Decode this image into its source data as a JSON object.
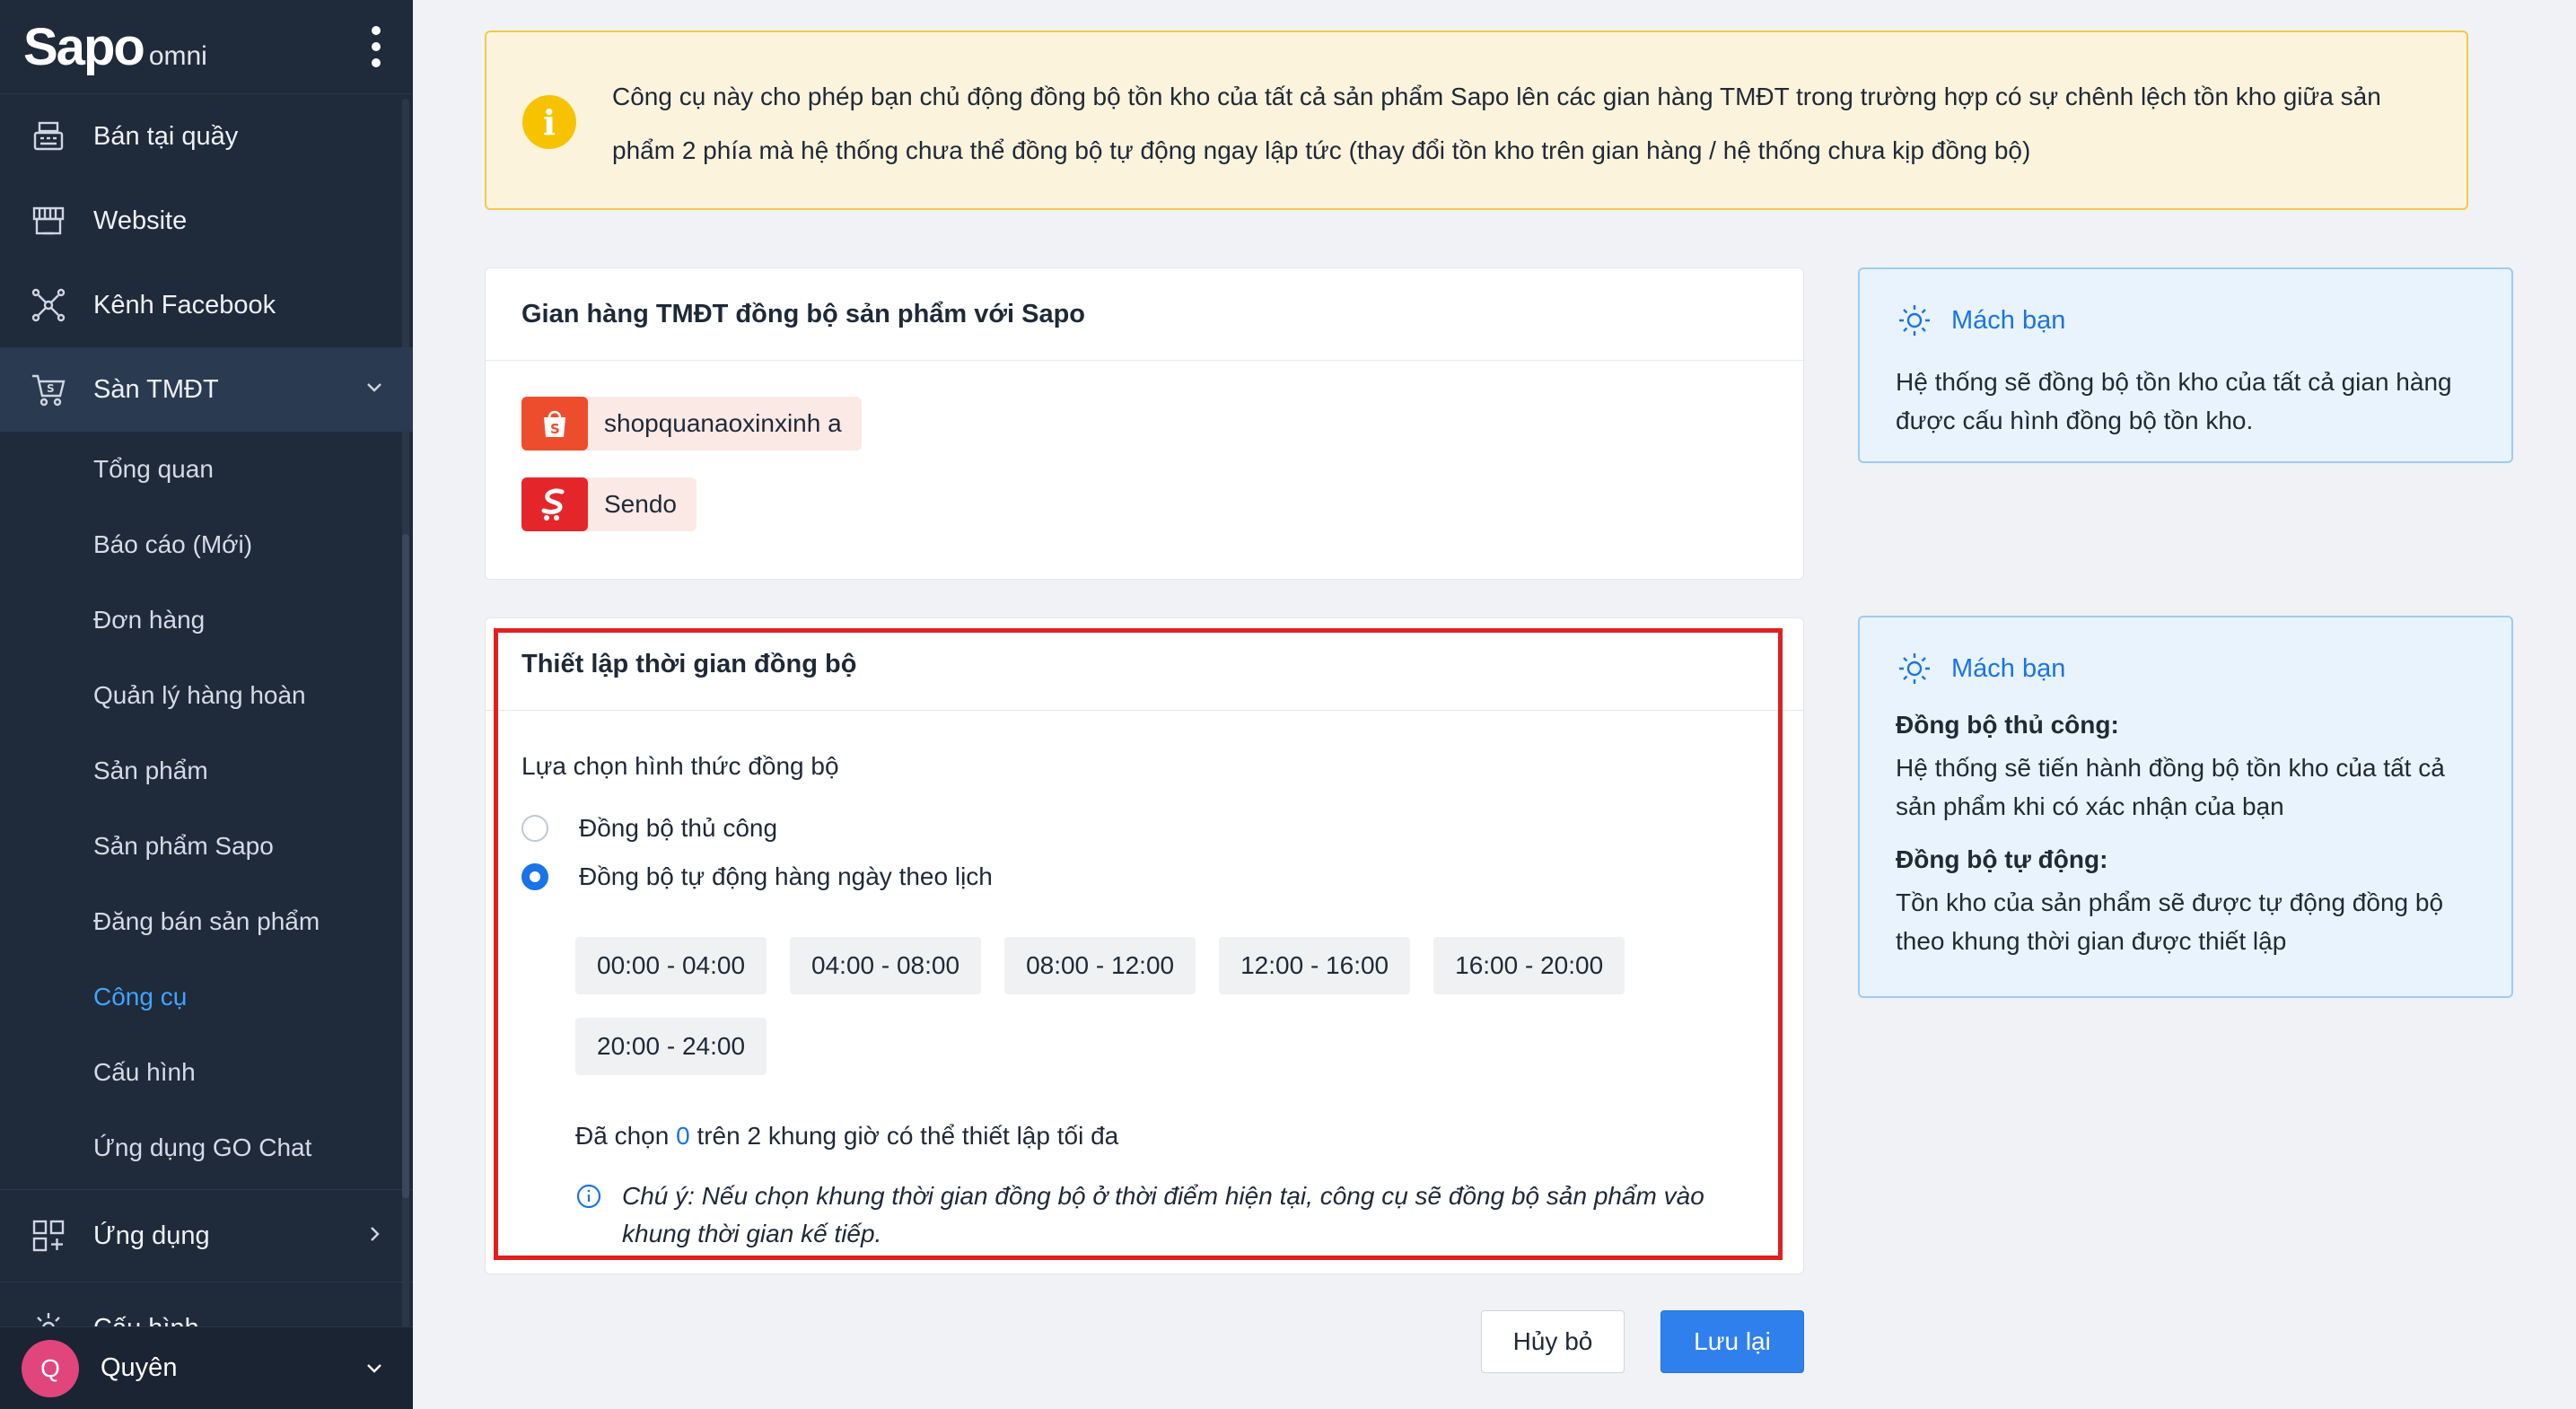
{
  "brand": {
    "name": "Sapo",
    "suffix": "omni"
  },
  "sidebar": {
    "items": [
      {
        "label": "Bán tại quầy"
      },
      {
        "label": "Website"
      },
      {
        "label": "Kênh Facebook"
      },
      {
        "label": "Sàn TMĐT"
      }
    ],
    "sub_items": [
      "Tổng quan",
      "Báo cáo (Mới)",
      "Đơn hàng",
      "Quản lý hàng hoàn",
      "Sản phẩm",
      "Sản phẩm Sapo",
      "Đăng bán sản phẩm",
      "Công cụ",
      "Cấu hình",
      "Ứng dụng GO Chat"
    ],
    "apps_label": "Ứng dụng",
    "settings_label": "Cấu hình",
    "user": {
      "initial": "Q",
      "name": "Quyên"
    }
  },
  "banner": {
    "text": "Công cụ này cho phép bạn chủ động đồng bộ tồn kho của tất cả sản phẩm Sapo lên các gian hàng TMĐT trong trường hợp có sự chênh lệch tồn kho giữa sản phẩm 2 phía mà hệ thống chưa thể đồng bộ tự động ngay lập tức (thay đổi tồn kho trên gian hàng / hệ thống chưa kịp đồng bộ)"
  },
  "stores": {
    "title": "Gian hàng TMĐT đồng bộ sản phẩm với Sapo",
    "list": [
      {
        "name": "shopquanaoxinxinh a"
      },
      {
        "name": "Sendo"
      }
    ]
  },
  "sync": {
    "title": "Thiết lập thời gian đồng bộ",
    "choose_label": "Lựa chọn hình thức đồng bộ",
    "options": [
      {
        "label": "Đồng bộ thủ công",
        "checked": false
      },
      {
        "label": "Đồng bộ tự động hàng ngày theo lịch",
        "checked": true
      }
    ],
    "slots": [
      "00:00 - 04:00",
      "04:00 - 08:00",
      "08:00 - 12:00",
      "12:00 - 16:00",
      "16:00 - 20:00",
      "20:00 - 24:00"
    ],
    "selected_prefix": "Đã chọn",
    "selected_count": "0",
    "selected_suffix": "trên 2 khung giờ có thể thiết lập tối đa",
    "note": "Chú ý: Nếu chọn khung thời gian đồng bộ ở thời điểm hiện tại, công cụ sẽ đồng bộ sản phẩm vào khung thời gian kế tiếp."
  },
  "tips": [
    {
      "title": "Mách bạn",
      "text": "Hệ thống sẽ đồng bộ tồn kho của tất cả gian hàng được cấu hình đồng bộ tồn kho."
    },
    {
      "title": "Mách bạn",
      "blocks": [
        {
          "heading": "Đồng bộ thủ công:",
          "text": "Hệ thống sẽ tiến hành đồng bộ tồn kho của tất cả sản phẩm khi có xác nhận của bạn"
        },
        {
          "heading": "Đồng bộ tự động:",
          "text": "Tồn kho của sản phẩm sẽ được tự động đồng bộ theo khung thời gian được thiết lập"
        }
      ]
    }
  ],
  "actions": {
    "cancel_label": "Hủy bỏ",
    "save_label": "Lưu lại"
  },
  "colors": {
    "accent": "#2f80ed",
    "sidebar_bg": "#1f2a3a",
    "highlight_frame": "#e02020",
    "warning": "#f7c300"
  }
}
